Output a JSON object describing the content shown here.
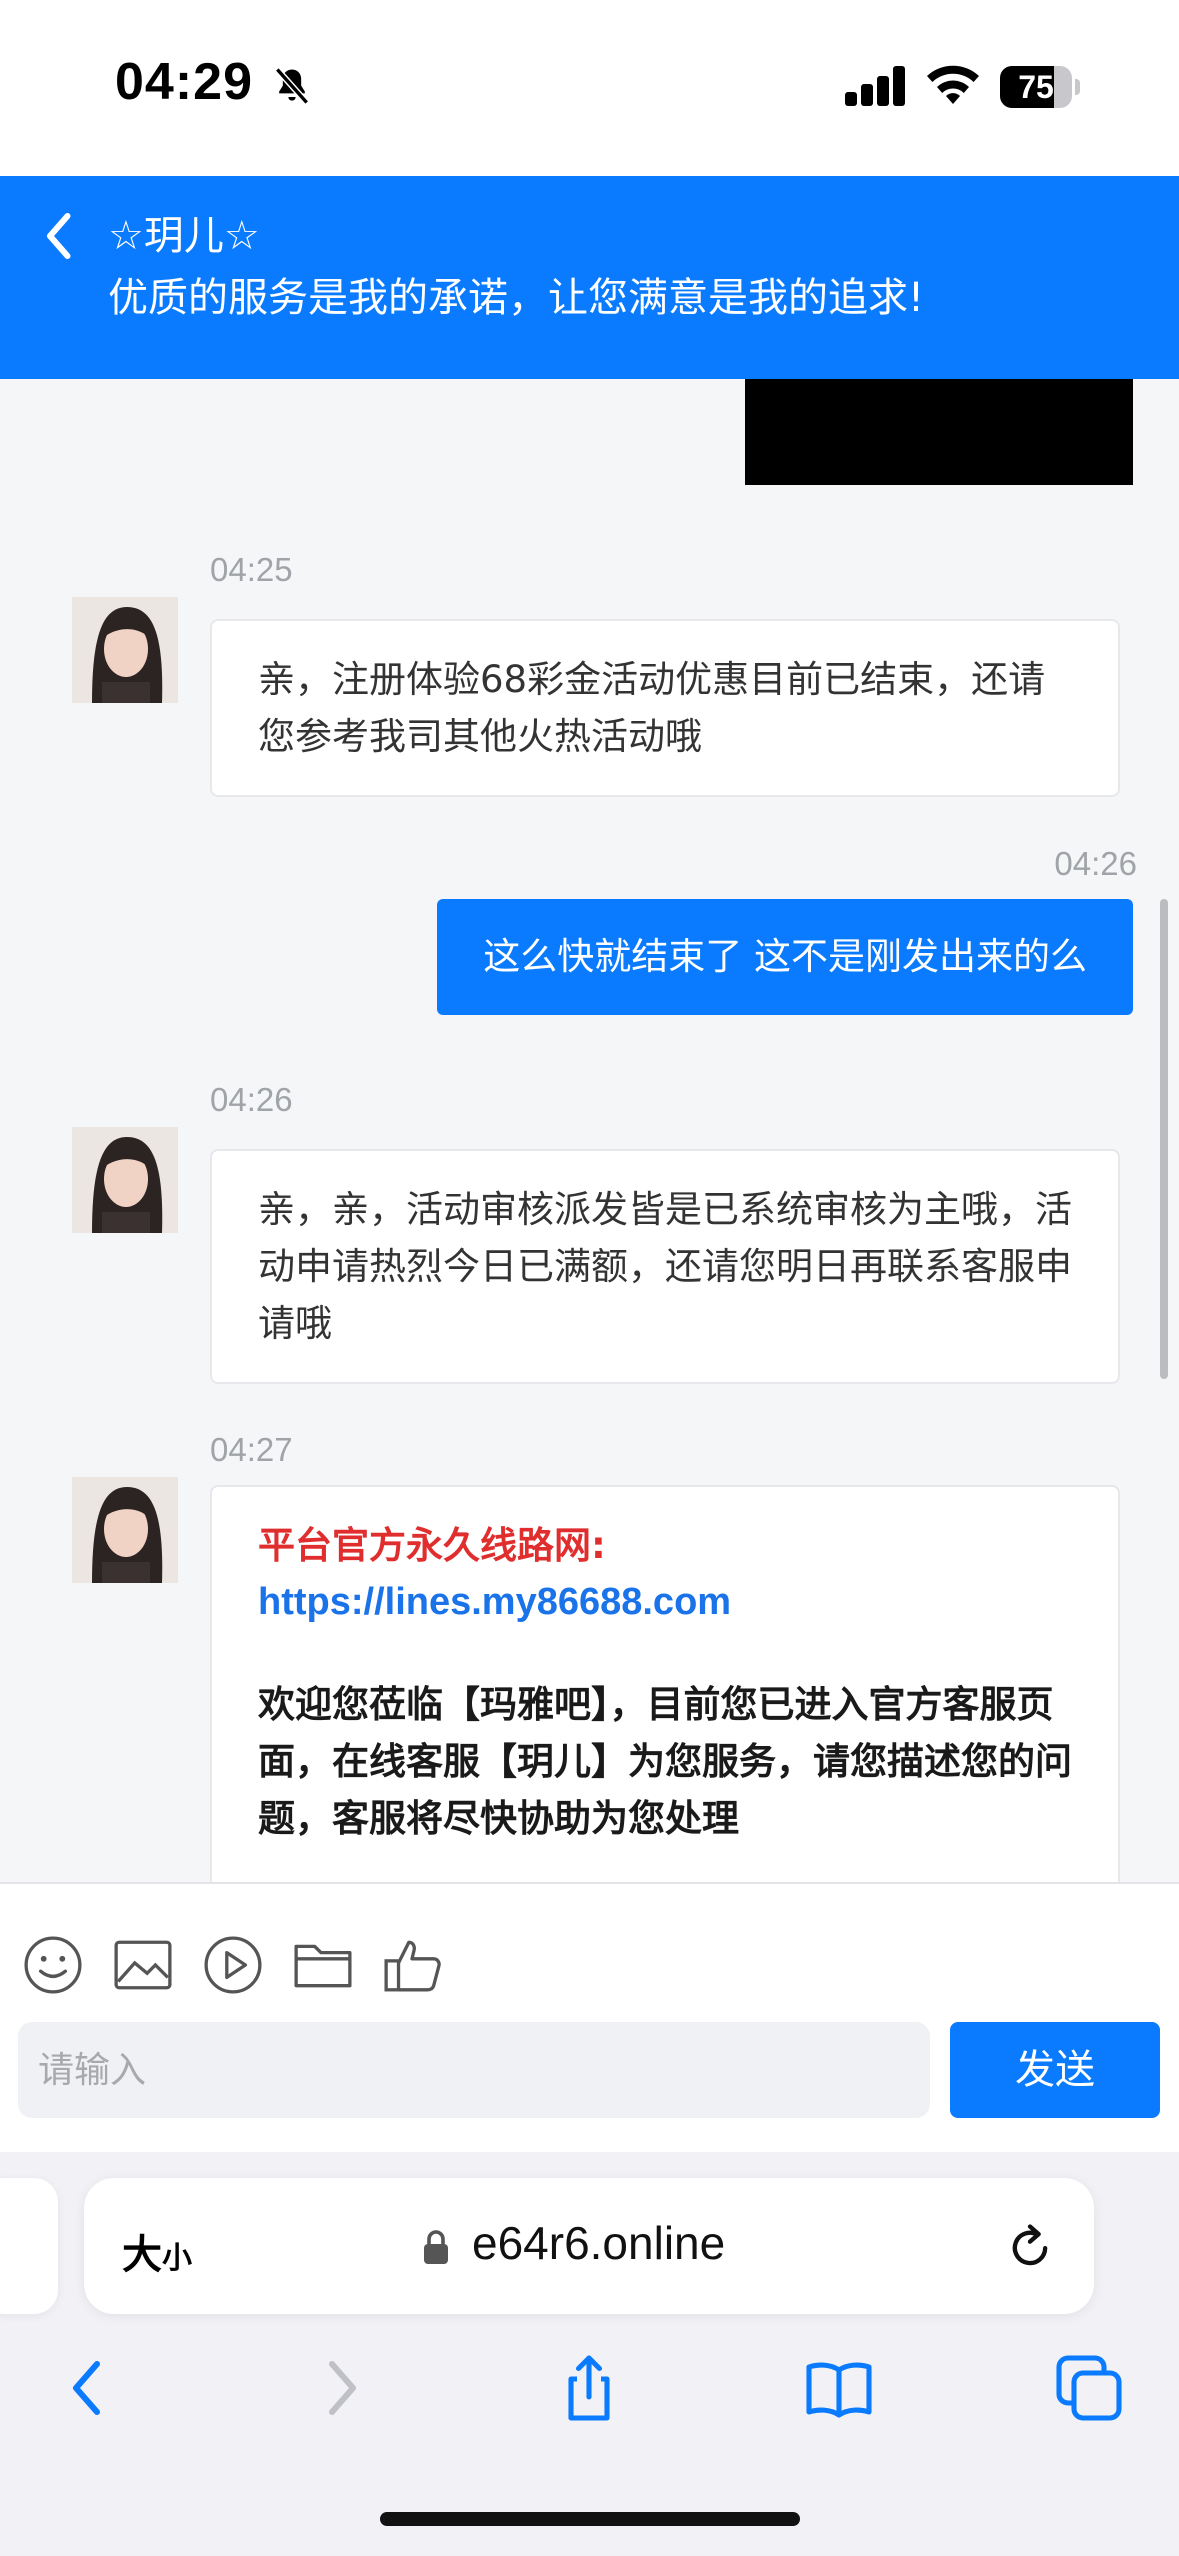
{
  "status_bar": {
    "time": "04:29",
    "battery": "75",
    "battery_level": 0.75,
    "icons": [
      "bell-slash-icon",
      "cellular-signal-icon",
      "wifi-icon",
      "battery-icon"
    ]
  },
  "chat_header": {
    "agent_name": "☆玥儿☆",
    "slogan": "优质的服务是我的承诺，让您满意是我的追求!"
  },
  "messages": [
    {
      "from": "user",
      "type": "image"
    },
    {
      "from": "agent",
      "time": "04:25",
      "text": "亲，注册体验68彩金活动优惠目前已结束，还请您参考我司其他火热活动哦"
    },
    {
      "from": "user",
      "time": "04:26",
      "text": "这么快就结束了 这不是刚发出来的么"
    },
    {
      "from": "agent",
      "time": "04:26",
      "text": "亲，亲，活动审核派发皆是已系统审核为主哦，活动申请热烈今日已满额，还请您明日再联系客服申请哦"
    },
    {
      "from": "agent",
      "time": "04:27",
      "heading": "平台官方永久线路网:",
      "link": "https://lines.my86688.com",
      "text": "欢迎您莅临【玛雅吧】，目前您已进入官方客服页面，在线客服【玥儿】为您服务，请您描述您的问题，客服将尽快协助为您处理"
    }
  ],
  "toolbar": {
    "icons": [
      "emoji-icon",
      "image-icon",
      "video-icon",
      "folder-icon",
      "thumbs-up-icon"
    ],
    "input_placeholder": "请输入",
    "input_value": "",
    "send_label": "发送"
  },
  "browser": {
    "reader_label": "大",
    "reader_small": "小",
    "url": "e64r6.online",
    "nav_icons": [
      "back-icon",
      "forward-icon",
      "share-icon",
      "bookmarks-icon",
      "tabs-icon"
    ]
  },
  "colors": {
    "accent": "#0a7bff",
    "heading_red": "#e02e2e",
    "link_blue": "#1a73e8",
    "background": "#f5f6f8"
  }
}
